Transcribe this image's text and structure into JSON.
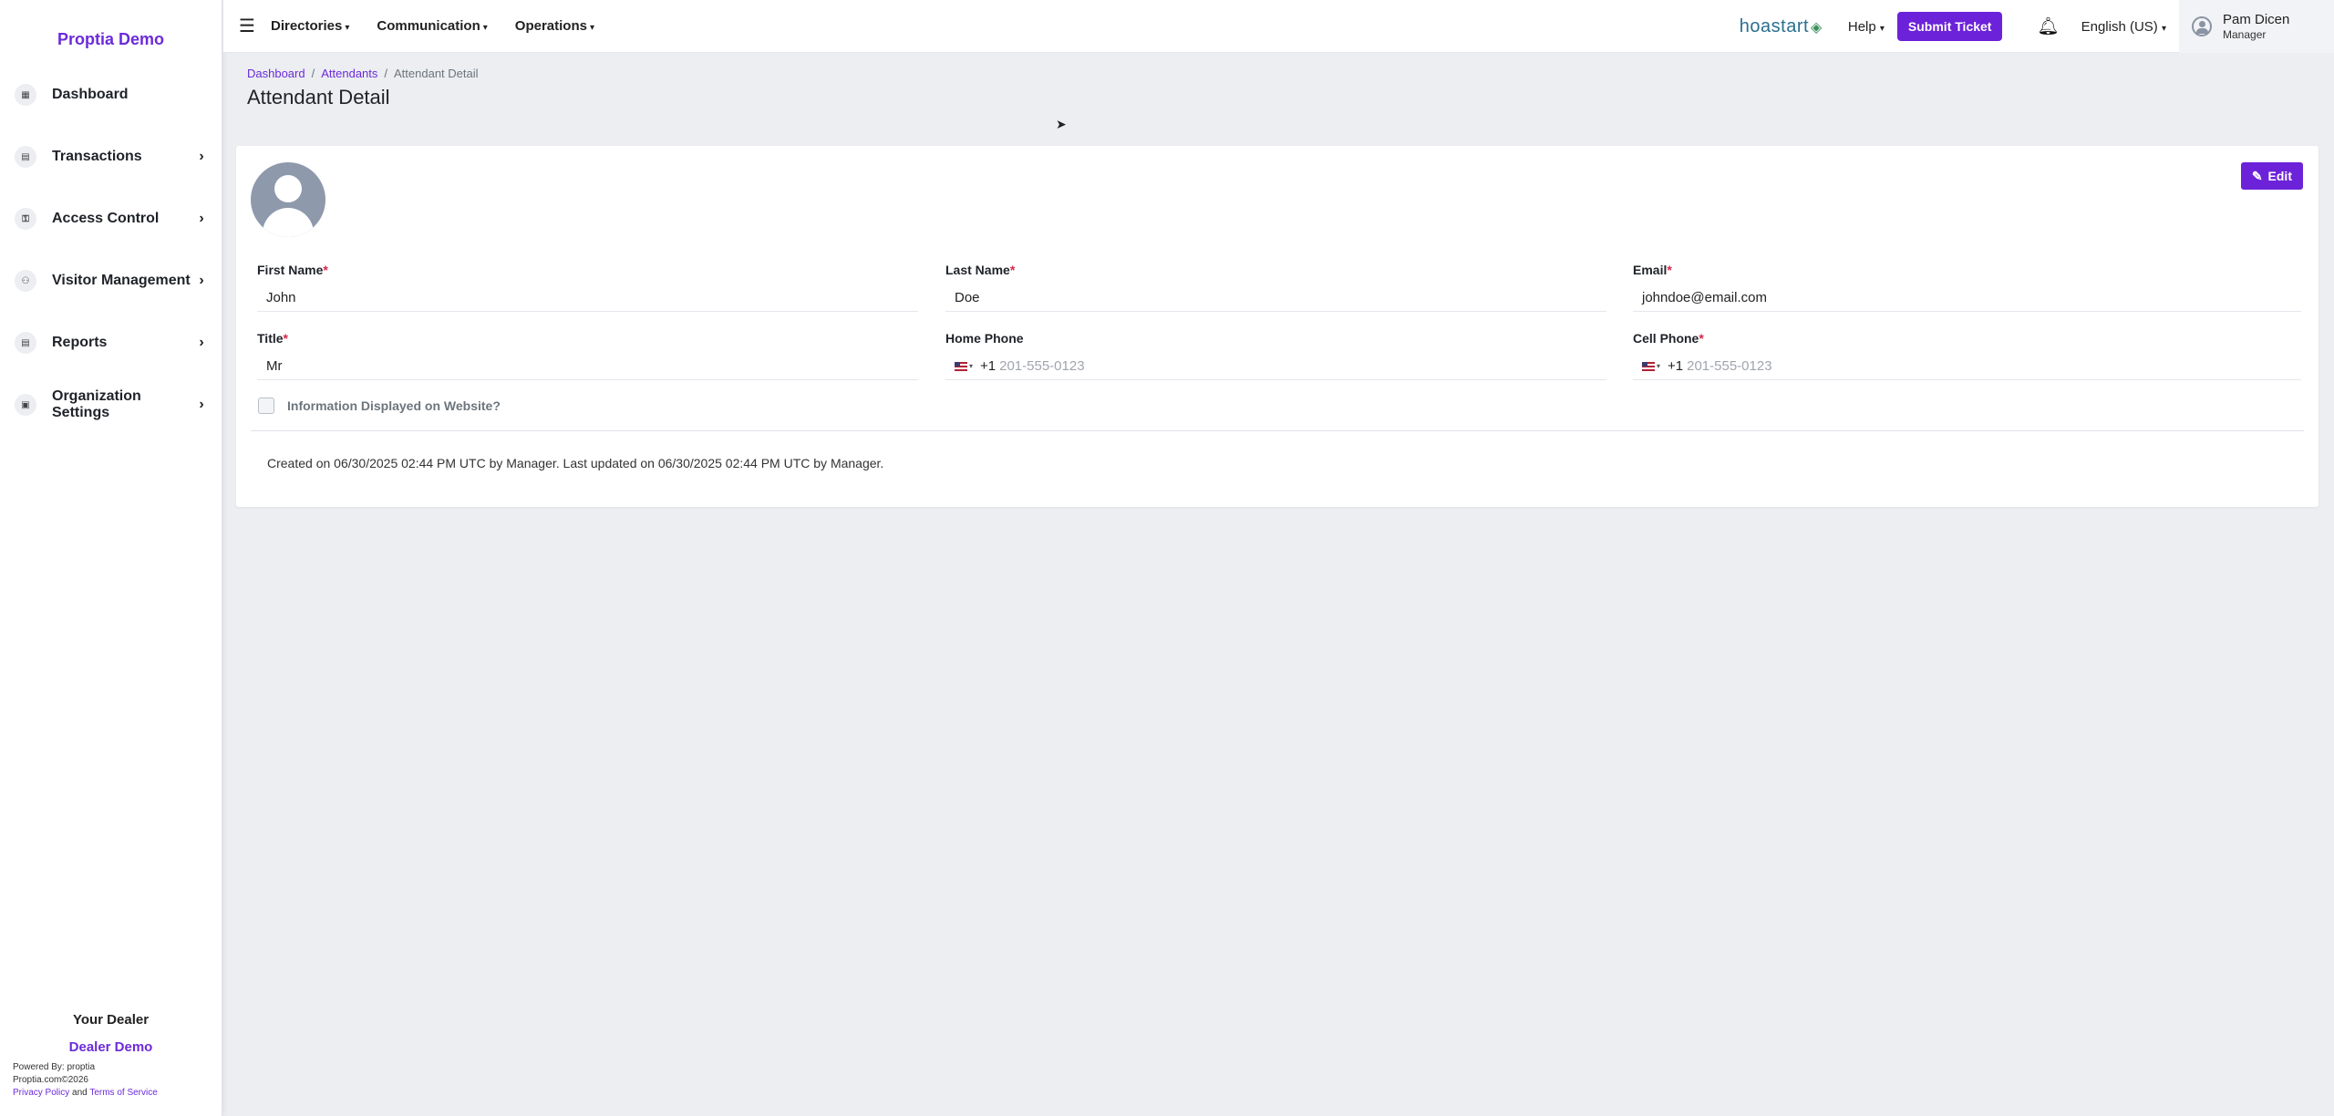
{
  "sidebar": {
    "brand": "Proptia Demo",
    "items": [
      {
        "label": "Dashboard",
        "icon": "dashboard-icon",
        "glyph": "▦",
        "chevron": ""
      },
      {
        "label": "Transactions",
        "icon": "transactions-icon",
        "glyph": "▤",
        "chevron": "›"
      },
      {
        "label": "Access Control",
        "icon": "key-icon",
        "glyph": "⚿",
        "chevron": "›"
      },
      {
        "label": "Visitor Management",
        "icon": "visitor-icon",
        "glyph": "⚇",
        "chevron": "›"
      },
      {
        "label": "Reports",
        "icon": "reports-icon",
        "glyph": "▤",
        "chevron": "›"
      },
      {
        "label": "Organization Settings",
        "icon": "settings-icon",
        "glyph": "▣",
        "chevron": "›"
      }
    ],
    "dealer_heading": "Your Dealer",
    "dealer_name": "Dealer Demo",
    "powered_by": "Powered By: proptia",
    "copyright": "Proptia.com©2026",
    "privacy": "Privacy Policy",
    "and": "and",
    "terms": "Terms of Service"
  },
  "topbar": {
    "menu_icon": "☰",
    "menus": [
      "Directories",
      "Communication",
      "Operations"
    ],
    "logo_text": "hoastart",
    "help": "Help",
    "submit_ticket": "Submit Ticket",
    "language": "English (US)",
    "user_name": "Pam Dicen",
    "user_role": "Manager"
  },
  "breadcrumb": {
    "items": [
      "Dashboard",
      "Attendants"
    ],
    "current": "Attendant Detail"
  },
  "page": {
    "title": "Attendant Detail"
  },
  "card": {
    "edit_label": "Edit",
    "fields": {
      "first_name": {
        "label": "First Name",
        "value": "John"
      },
      "last_name": {
        "label": "Last Name",
        "value": "Doe"
      },
      "email": {
        "label": "Email",
        "value": "johndoe@email.com"
      },
      "title": {
        "label": "Title",
        "value": "Mr"
      },
      "home_phone": {
        "label": "Home Phone",
        "dial": "+1",
        "placeholder": "201-555-0123"
      },
      "cell_phone": {
        "label": "Cell Phone",
        "dial": "+1",
        "placeholder": "201-555-0123"
      }
    },
    "checkbox_label": "Information Displayed on Website?",
    "checkbox_checked": false,
    "meta": "Created on 06/30/2025 02:44 PM UTC by Manager. Last updated on 06/30/2025 02:44 PM UTC by Manager."
  },
  "colors": {
    "accent": "#6c22d8",
    "required": "#d6274a",
    "background": "#eceef2"
  }
}
